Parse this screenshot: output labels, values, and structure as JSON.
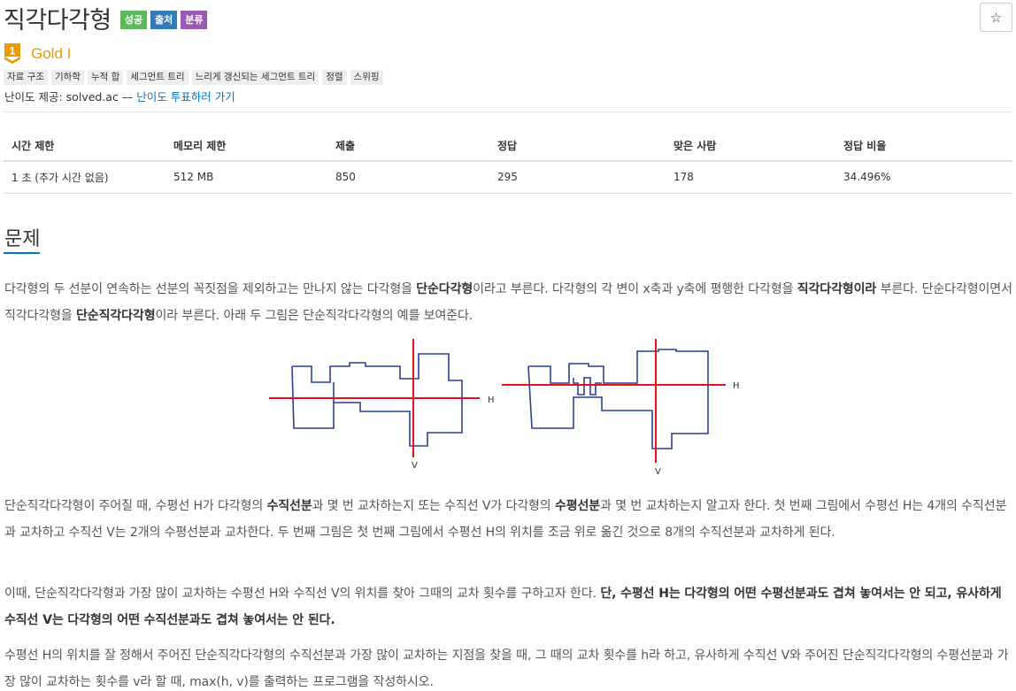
{
  "header": {
    "title": "직각다각형",
    "badges": [
      {
        "label": "성공",
        "color": "#5cb85c"
      },
      {
        "label": "출처",
        "color": "#337ab7"
      },
      {
        "label": "분류",
        "color": "#9b59b6"
      }
    ],
    "star_icon": "☆"
  },
  "tier": {
    "badge_number": "1",
    "name": "Gold I",
    "color": "#ec9a00"
  },
  "tags": [
    "자료 구조",
    "기하학",
    "누적 합",
    "세그먼트 트리",
    "느리게 갱신되는 세그먼트 트리",
    "정렬",
    "스위핑"
  ],
  "credit": {
    "prefix": "난이도 제공: solved.ac — ",
    "link": "난이도 투표하러 가기"
  },
  "info_table": {
    "headers": [
      "시간 제한",
      "메모리 제한",
      "제출",
      "정답",
      "맞은 사람",
      "정답 비율"
    ],
    "row": [
      "1 초 (추가 시간 없음)",
      "512 MB",
      "850",
      "295",
      "178",
      "34.496%"
    ]
  },
  "problem": {
    "heading": "문제",
    "p1": {
      "a": "다각형의 두 선분이 연속하는 선분의 꼭짓점을 제외하고는 만나지 않는 다각형을 ",
      "b": "단순다각형",
      "c": "이라고 부른다. 다각형의 각 변이 x축과 y축에 평행한 다각형을 ",
      "d": "직각다각형이라",
      "e": " 부른다. 단순다각형이면서 직각다각형을 ",
      "f": "단순직각다각형",
      "g": "이라 부른다. 아래 두 그림은 단순직각다각형의 예를 보여준다."
    },
    "figure_labels": {
      "h1": "H",
      "v1": "V",
      "h2": "H",
      "v2": "V"
    },
    "p2": {
      "a": "단순직각다각형이 주어질 때, 수평선 H가 다각형의 ",
      "b": "수직선분",
      "c": "과 몇 번 교차하는지 또는 수직선 V가 다각형의 ",
      "d": "수평선분",
      "e": "과 몇 번 교차하는지 알고자 한다. 첫 번째 그림에서 수평선 H는 4개의 수직선분과 교차하고 수직선 V는 2개의 수평선분과 교차한다. 두 번째 그림은 첫 번째 그림에서 수평선 H의 위치를 조금 위로 옮긴 것으로 8개의 수직선분과 교차하게 된다."
    },
    "p3": {
      "a": "이때, 단순직각다각형과 가장 많이 교차하는 수평선 H와 수직선 V의 위치를 찾아 그때의 교차 횟수를 구하고자 한다. ",
      "b": "단, 수평선 H는 다각형의 어떤 수평선분과도 겹쳐 놓여서는 안 되고, 유사하게 수직선 V는 다각형의 어떤 수직선분과도 겹쳐 놓여서는 안 된다."
    },
    "p4": "수평선 H의 위치를 잘 정해서 주어진 단순직각다각형의 수직선분과 가장 많이 교차하는 지점을 찾을 때, 그 때의 교차 횟수를 h라 하고, 유사하게 수직선 V와 주어진 단순직각다각형의 수평선분과 가장 많이 교차하는 횟수를 v라 할 때, max(h, v)를 출력하는 프로그램을 작성하시오."
  },
  "colors": {
    "polygon": "#2b3f8f",
    "line": "#e3141b",
    "link": "#0076c0"
  }
}
